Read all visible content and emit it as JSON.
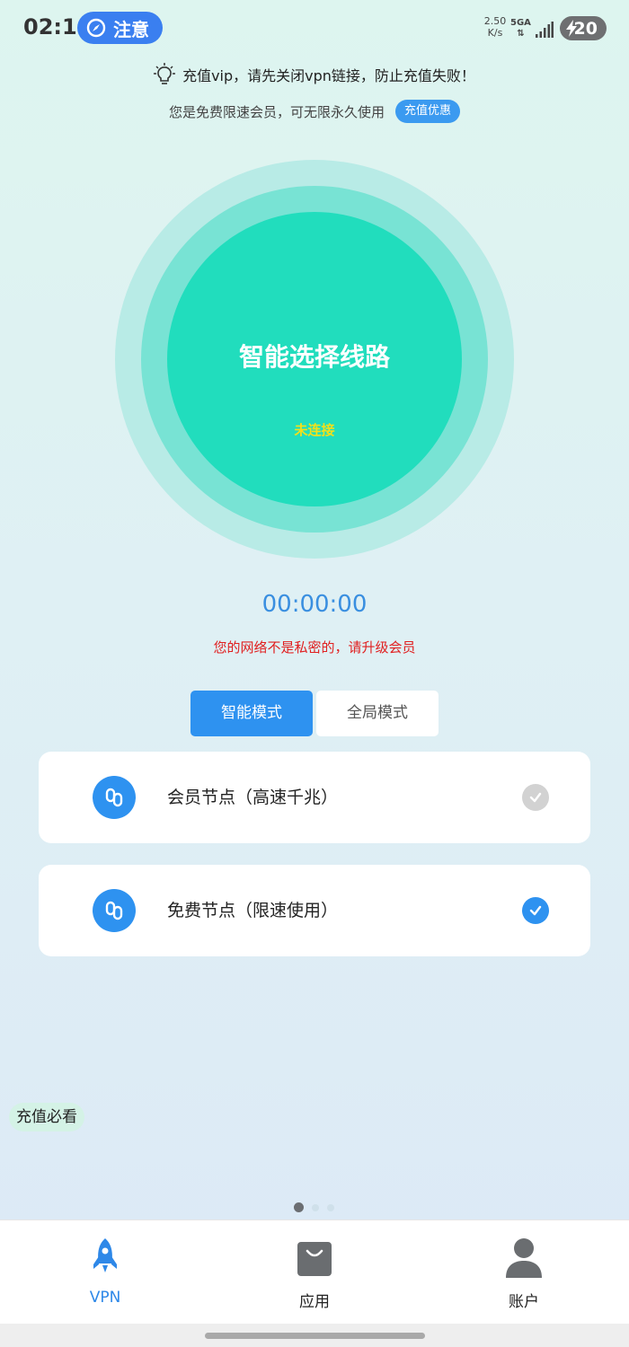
{
  "status_bar": {
    "time": "02:10",
    "notice_label": "注意",
    "speed_value": "2.50",
    "speed_unit": "K/s",
    "network_type": "5GA",
    "network_arrows": "⇅",
    "battery_level": "20"
  },
  "tips": {
    "vpn_warning": "充值vip，请先关闭vpn链接，防止充值失败！",
    "member_info": "您是免费限速会员，可无限永久使用",
    "recharge_offer": "充值优惠"
  },
  "connect": {
    "title": "智能选择线路",
    "status": "未连接"
  },
  "timer": "00:00:00",
  "privacy_warning": "您的网络不是私密的，请升级会员",
  "modes": {
    "smart": "智能模式",
    "global": "全局模式",
    "selected": "smart"
  },
  "nodes": [
    {
      "label": "会员节点（高速千兆）",
      "selected": false
    },
    {
      "label": "免费节点（限速使用）",
      "selected": true
    }
  ],
  "recharge_must_read": "充值必看",
  "pager": {
    "count": 3,
    "active": 0
  },
  "nav": {
    "vpn": "VPN",
    "apps": "应用",
    "account": "账户",
    "active": "vpn"
  },
  "colors": {
    "accent": "#2e92f0",
    "circle_core": "#21ddbd",
    "warning_red": "#e02020",
    "status_yellow": "#f4e019"
  }
}
